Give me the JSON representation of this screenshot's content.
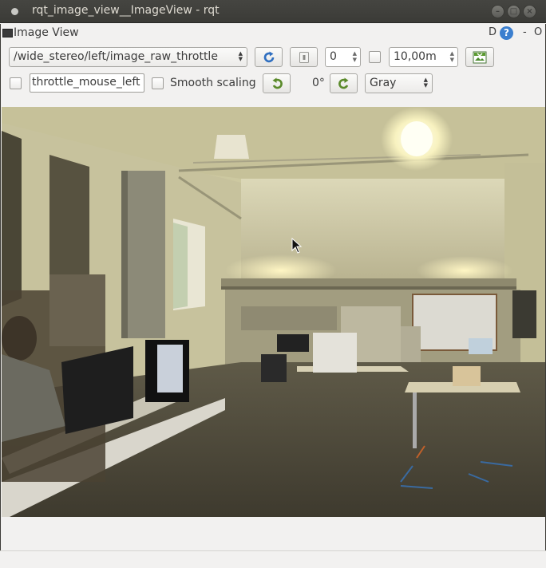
{
  "window": {
    "title": "rqt_image_view__ImageView - rqt"
  },
  "dock": {
    "title": "Image View",
    "d_label": "D",
    "help_label": "?",
    "minimize_label": "-",
    "close_label": "O"
  },
  "toolbar": {
    "topic": "/wide_stereo/left/image_raw_throttle",
    "spin_value": "0",
    "depth_value": "10,00m",
    "mouse_topic": "throttle_mouse_left",
    "smooth_scaling_label": "Smooth scaling",
    "rotation_label": "0°",
    "color_scheme": "Gray"
  },
  "icons": {
    "refresh": "refresh-icon",
    "zoom_1": "zoom-1-icon",
    "save": "save-image-icon",
    "rotate_left": "rotate-left-icon",
    "rotate_right": "rotate-right-icon",
    "cursor": "mouse-cursor-icon"
  },
  "colors": {
    "titlebar": "#3c3b37",
    "accent_green": "#5a9a2f",
    "accent_blue": "#3b7fcf"
  }
}
